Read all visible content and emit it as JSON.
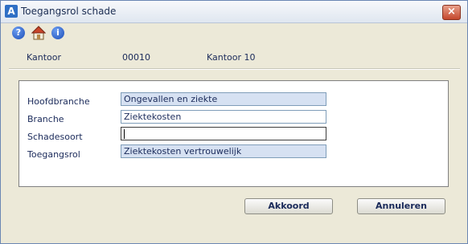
{
  "window": {
    "title": "Toegangsrol schade",
    "close_symbol": "×"
  },
  "toolbar": {
    "icons": [
      "help-icon",
      "home-icon",
      "info-icon"
    ],
    "help_glyph": "?",
    "info_glyph": "i"
  },
  "header": {
    "label": "Kantoor",
    "code": "00010",
    "name": "Kantoor 10"
  },
  "form": {
    "hoofdbranche_label": "Hoofdbranche",
    "hoofdbranche_value": "Ongevallen en ziekte",
    "branche_label": "Branche",
    "branche_value": "Ziektekosten",
    "schadesoort_label": "Schadesoort",
    "schadesoort_value": "",
    "toegangsrol_label": "Toegangsrol",
    "toegangsrol_value": "Ziektekosten vertrouwelijk"
  },
  "buttons": {
    "ok_label": "Akkoord",
    "cancel_label": "Annuleren"
  },
  "colors": {
    "readonly_field_bg": "#d6e1f2",
    "window_bg": "#ece9d8",
    "text": "#1a2a5a"
  }
}
